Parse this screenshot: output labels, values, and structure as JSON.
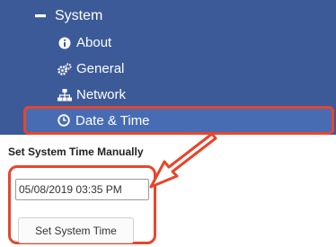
{
  "nav": {
    "section": {
      "label": "System",
      "icon": "minus-icon"
    },
    "items": [
      {
        "label": "About",
        "icon": "info-circle-icon"
      },
      {
        "label": "General",
        "icon": "gears-icon"
      },
      {
        "label": "Network",
        "icon": "sitemap-icon"
      },
      {
        "label": "Date & Time",
        "icon": "clock-icon",
        "active": true
      }
    ]
  },
  "panel": {
    "title": "Set System Time Manually",
    "datetime_value": "05/08/2019 03:35 PM",
    "button_label": "Set System Time"
  },
  "colors": {
    "nav_background": "#3c5a98",
    "nav_active_background": "#476cb4",
    "annotation": "#e8452c"
  }
}
